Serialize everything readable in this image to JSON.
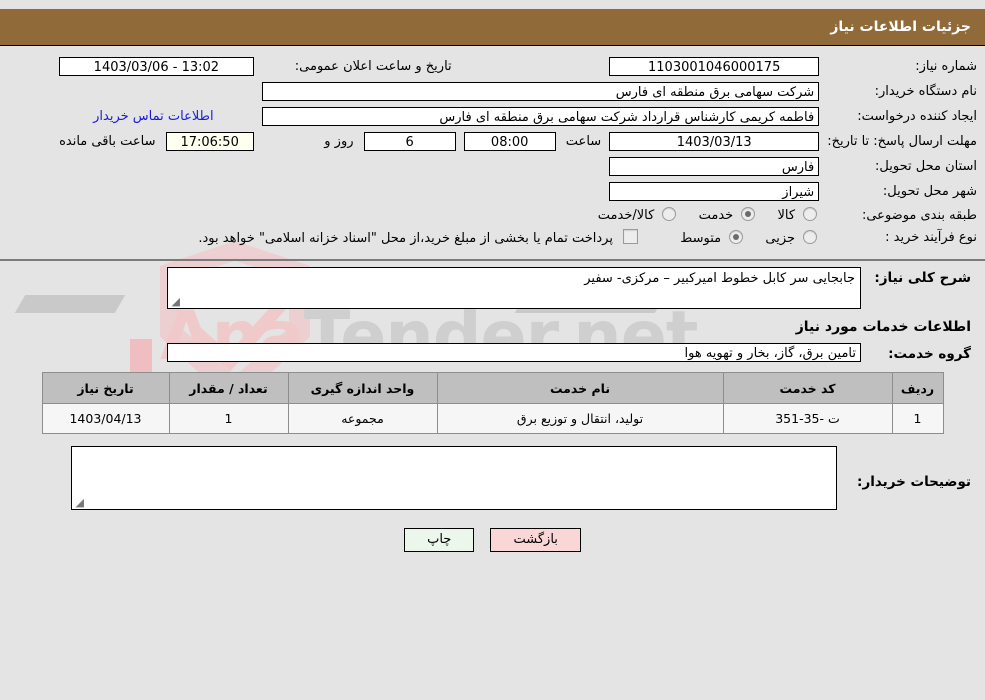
{
  "window": {
    "title": "جزئیات اطلاعات نیاز",
    "header_bg": "#906a38"
  },
  "details": {
    "need_number_label": "شماره نیاز:",
    "need_number_value": "1103001046000175",
    "announce_datetime_label": "تاریخ و ساعت اعلان عمومی:",
    "announce_datetime_value": "13:02 - 1403/03/06",
    "buyer_org_label": "نام دستگاه خریدار:",
    "buyer_org_value": "شرکت سهامی برق منطقه ای فارس",
    "creator_label": "ایجاد کننده درخواست:",
    "creator_value": "فاطمه کریمی کارشناس قرارداد شرکت سهامی برق منطقه ای فارس",
    "contact_link": "اطلاعات تماس خریدار",
    "deadline_label": "مهلت ارسال پاسخ: تا تاریخ:",
    "deadline_date": "1403/03/13",
    "deadline_time_label": "ساعت",
    "deadline_time": "08:00",
    "remaining_days": "6",
    "remaining_days_label": "روز و",
    "remaining_time": "17:06:50",
    "remaining_time_label": "ساعت باقی مانده",
    "province_label": "استان محل تحویل:",
    "province_value": "فارس",
    "city_label": "شهر محل تحویل:",
    "city_value": "شیراز",
    "category_label": "طبقه بندی موضوعی:",
    "category_options": [
      {
        "label": "کالا",
        "selected": false
      },
      {
        "label": "خدمت",
        "selected": true
      },
      {
        "label": "کالا/خدمت",
        "selected": false
      }
    ],
    "process_label": "نوع فرآیند خرید :",
    "process_options": [
      {
        "label": "جزیی",
        "selected": false
      },
      {
        "label": "متوسط",
        "selected": true
      }
    ],
    "treasury_checkbox_checked": false,
    "treasury_text": "پرداخت تمام یا بخشی از مبلغ خرید،از محل \"اسناد خزانه اسلامی\" خواهد بود."
  },
  "summary": {
    "label": "شرح کلی نیاز:",
    "value": "جابجایی سر کابل خطوط امیرکبیر – مرکزی- سفیر"
  },
  "services": {
    "heading": "اطلاعات خدمات مورد نیاز",
    "group_label": "گروه خدمت:",
    "group_value": "تامین برق، گاز، بخار و تهویه هوا",
    "columns": [
      "ردیف",
      "کد خدمت",
      "نام خدمت",
      "واحد اندازه گیری",
      "تعداد / مقدار",
      "تاریخ نیاز"
    ],
    "rows": [
      {
        "row": "1",
        "code": "ت -35-351",
        "name": "تولید، انتقال و توزیع برق",
        "unit": "مجموعه",
        "quantity": "1",
        "need_date": "1403/04/13"
      }
    ]
  },
  "buyer_notes": {
    "label": "توضیحات خریدار:",
    "value": ""
  },
  "buttons": {
    "print": "چاپ",
    "back": "بازگشت"
  },
  "watermark": {
    "text_left": "Ana",
    "text_right": "Tender.net"
  }
}
